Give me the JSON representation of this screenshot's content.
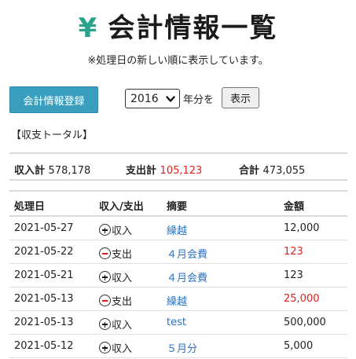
{
  "header": {
    "yen_symbol": "¥",
    "title": "会計情報一覧",
    "note": "※処理日の新しい順に表示しています。"
  },
  "toolbar": {
    "register_label": "会計情報登録",
    "year_value": "2016",
    "year_suffix": "年分を",
    "show_label": "表示"
  },
  "section": {
    "label": "【収支トータル】"
  },
  "totals": {
    "income_label": "収入計",
    "income_value": "578,178",
    "expense_label": "支出計",
    "expense_value": "105,123",
    "sum_label": "合計",
    "sum_value": "473,055"
  },
  "table": {
    "headers": [
      "処理日",
      "収入/支出",
      "摘要",
      "金額"
    ],
    "rows": [
      {
        "date": "2021-05-27",
        "type": "income",
        "type_label": "収入",
        "memo": "繰越",
        "amount": "12,000"
      },
      {
        "date": "2021-05-22",
        "type": "expense",
        "type_label": "支出",
        "memo": "４月会費",
        "amount": "123"
      },
      {
        "date": "2021-05-21",
        "type": "income",
        "type_label": "収入",
        "memo": "４月会費",
        "amount": "123"
      },
      {
        "date": "2021-05-13",
        "type": "expense",
        "type_label": "支出",
        "memo": "繰越",
        "amount": "25,000"
      },
      {
        "date": "2021-05-13",
        "type": "income",
        "type_label": "収入",
        "memo": "test",
        "amount": "500,000"
      },
      {
        "date": "2021-05-12",
        "type": "income",
        "type_label": "収入",
        "memo": "５月分",
        "amount": "5,000"
      }
    ]
  },
  "colors": {
    "accent": "#2aa38d",
    "button": "#3a9fbf",
    "link": "#2a72c4",
    "expense": "#e0211d"
  }
}
